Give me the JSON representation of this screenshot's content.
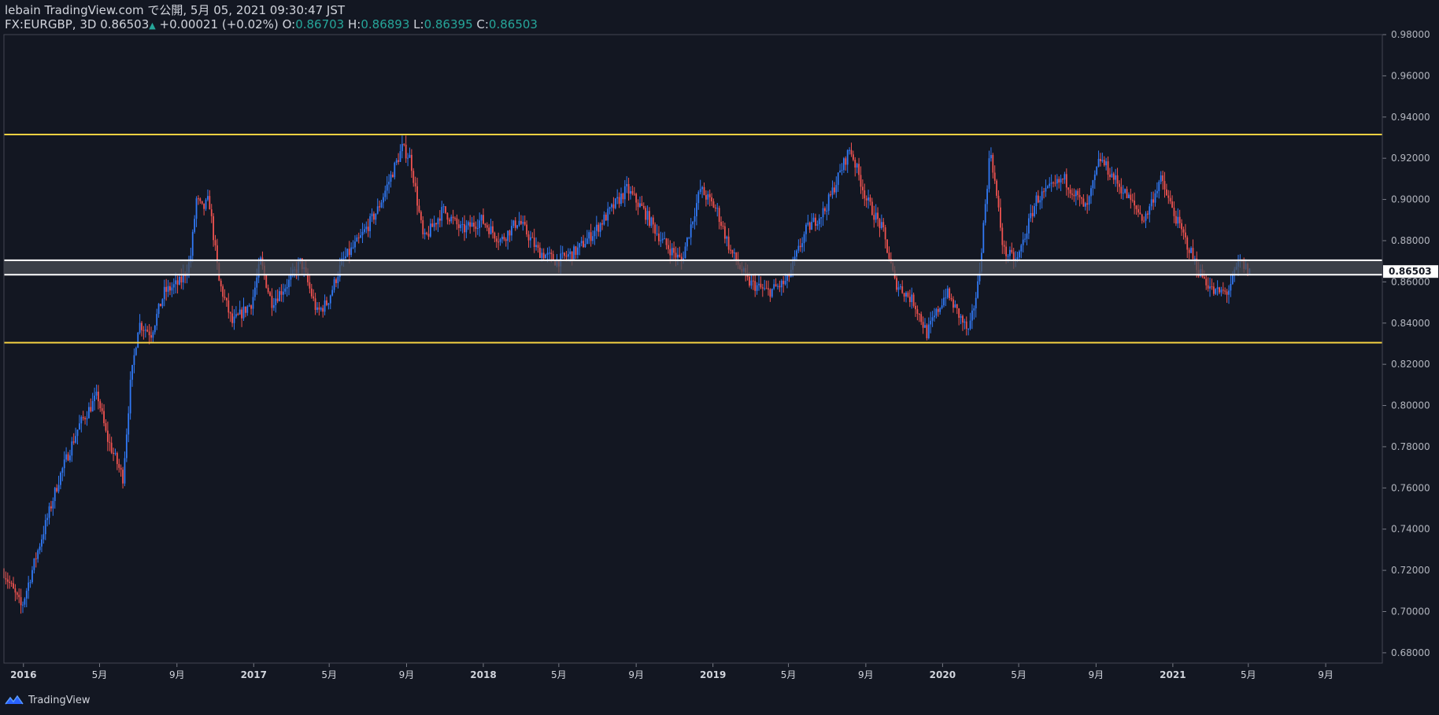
{
  "header": {
    "line1": "lebain TradingView.com で公開, 5月 05, 2021 09:30:47 JST",
    "symbol": "FX:EURGBP, 3D",
    "last": "0.86503",
    "change": "+0.00021 (+0.02%)",
    "open_label": "O:",
    "open": "0.86703",
    "high_label": "H:",
    "high": "0.86893",
    "low_label": "L:",
    "low": "0.86395",
    "close_label": "C:",
    "close": "0.86503"
  },
  "footer": {
    "brand": "TradingView",
    "logo_icon": "tradingview-logo-icon"
  },
  "colors": {
    "background": "#131722",
    "up": "#3179f5",
    "down": "#ef5350",
    "support_resistance": "#f5d142",
    "zone_border": "#ffffff",
    "zone_fill": "#4a4d55",
    "text": "#d1d4dc",
    "grid_axis": "#434651"
  },
  "chart_data": {
    "type": "candlestick",
    "title": "",
    "symbol": "FX:EURGBP",
    "timeframe": "3D",
    "ylim": [
      0.675,
      0.98
    ],
    "y_ticks": [
      "0.98000",
      "0.96000",
      "0.94000",
      "0.92000",
      "0.90000",
      "0.88000",
      "0.86000",
      "0.84000",
      "0.82000",
      "0.80000",
      "0.78000",
      "0.76000",
      "0.74000",
      "0.72000",
      "0.70000",
      "0.68000"
    ],
    "x_ticks": [
      "2016",
      "5月",
      "9月",
      "2017",
      "5月",
      "9月",
      "2018",
      "5月",
      "9月",
      "2019",
      "5月",
      "9月",
      "2020",
      "5月",
      "9月",
      "2021",
      "5月",
      "9月"
    ],
    "last_price_label": "0.86503",
    "horizontal_lines": [
      {
        "name": "resistance",
        "value": 0.9315
      },
      {
        "name": "support",
        "value": 0.8305
      }
    ],
    "zone": {
      "top": 0.8705,
      "bottom": 0.8635
    },
    "price_path": [
      [
        "2015-12-01",
        0.721
      ],
      [
        "2016-01-01",
        0.702
      ],
      [
        "2016-02-01",
        0.735
      ],
      [
        "2016-03-01",
        0.765
      ],
      [
        "2016-04-01",
        0.79
      ],
      [
        "2016-05-01",
        0.805
      ],
      [
        "2016-05-15",
        0.785
      ],
      [
        "2016-06-10",
        0.765
      ],
      [
        "2016-06-22",
        0.81
      ],
      [
        "2016-07-05",
        0.84
      ],
      [
        "2016-07-25",
        0.835
      ],
      [
        "2016-08-15",
        0.855
      ],
      [
        "2016-09-10",
        0.86
      ],
      [
        "2016-09-25",
        0.87
      ],
      [
        "2016-10-05",
        0.9
      ],
      [
        "2016-10-15",
        0.895
      ],
      [
        "2016-10-25",
        0.9
      ],
      [
        "2016-11-10",
        0.86
      ],
      [
        "2016-12-01",
        0.84
      ],
      [
        "2017-01-01",
        0.85
      ],
      [
        "2017-01-15",
        0.87
      ],
      [
        "2017-02-01",
        0.85
      ],
      [
        "2017-03-01",
        0.86
      ],
      [
        "2017-03-20",
        0.87
      ],
      [
        "2017-04-15",
        0.845
      ],
      [
        "2017-05-01",
        0.85
      ],
      [
        "2017-05-25",
        0.87
      ],
      [
        "2017-06-20",
        0.88
      ],
      [
        "2017-07-20",
        0.895
      ],
      [
        "2017-08-28",
        0.925
      ],
      [
        "2017-09-10",
        0.92
      ],
      [
        "2017-10-01",
        0.88
      ],
      [
        "2017-11-01",
        0.895
      ],
      [
        "2017-12-01",
        0.885
      ],
      [
        "2018-01-01",
        0.89
      ],
      [
        "2018-02-01",
        0.88
      ],
      [
        "2018-03-01",
        0.89
      ],
      [
        "2018-04-01",
        0.875
      ],
      [
        "2018-05-01",
        0.87
      ],
      [
        "2018-06-01",
        0.875
      ],
      [
        "2018-07-01",
        0.885
      ],
      [
        "2018-08-20",
        0.905
      ],
      [
        "2018-09-15",
        0.895
      ],
      [
        "2018-10-15",
        0.88
      ],
      [
        "2018-11-15",
        0.87
      ],
      [
        "2018-12-15",
        0.905
      ],
      [
        "2019-01-10",
        0.895
      ],
      [
        "2019-02-01",
        0.875
      ],
      [
        "2019-03-01",
        0.86
      ],
      [
        "2019-04-01",
        0.855
      ],
      [
        "2019-05-01",
        0.86
      ],
      [
        "2019-06-01",
        0.885
      ],
      [
        "2019-07-01",
        0.895
      ],
      [
        "2019-08-10",
        0.925
      ],
      [
        "2019-09-05",
        0.9
      ],
      [
        "2019-10-01",
        0.885
      ],
      [
        "2019-10-20",
        0.86
      ],
      [
        "2019-11-20",
        0.85
      ],
      [
        "2019-12-10",
        0.835
      ],
      [
        "2020-01-10",
        0.855
      ],
      [
        "2020-02-15",
        0.835
      ],
      [
        "2020-03-01",
        0.86
      ],
      [
        "2020-03-20",
        0.925
      ],
      [
        "2020-04-10",
        0.875
      ],
      [
        "2020-05-01",
        0.87
      ],
      [
        "2020-06-01",
        0.9
      ],
      [
        "2020-07-15",
        0.91
      ],
      [
        "2020-08-20",
        0.895
      ],
      [
        "2020-09-10",
        0.92
      ],
      [
        "2020-10-15",
        0.905
      ],
      [
        "2020-11-20",
        0.89
      ],
      [
        "2020-12-15",
        0.91
      ],
      [
        "2021-01-10",
        0.89
      ],
      [
        "2021-02-15",
        0.865
      ],
      [
        "2021-03-10",
        0.855
      ],
      [
        "2021-04-01",
        0.855
      ],
      [
        "2021-04-20",
        0.87
      ],
      [
        "2021-05-05",
        0.865
      ]
    ]
  }
}
